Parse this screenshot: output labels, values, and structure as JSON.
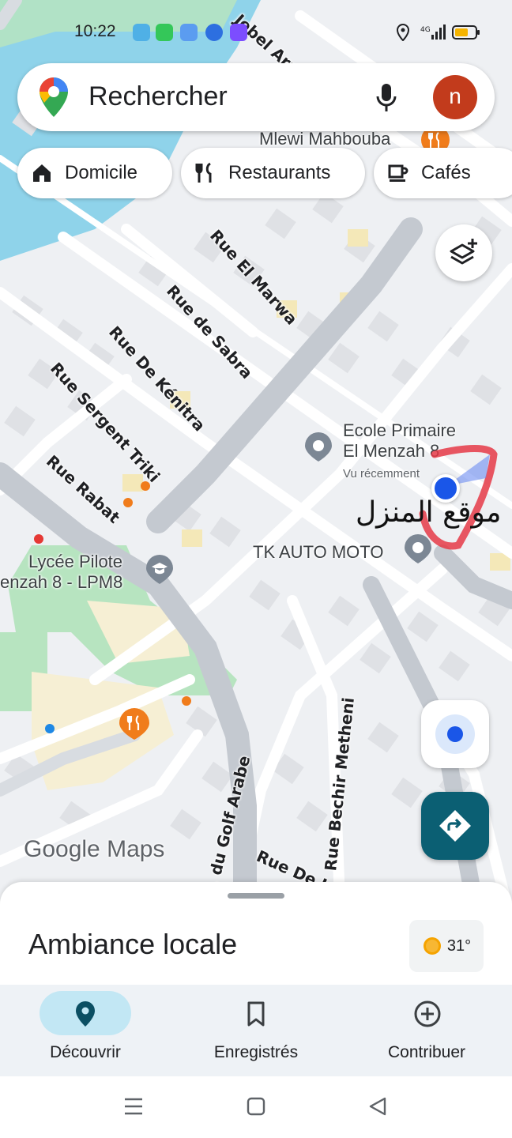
{
  "status_bar": {
    "time": "10:22"
  },
  "search": {
    "placeholder": "Rechercher",
    "avatar_letter": "n"
  },
  "chips": [
    {
      "label": "Domicile",
      "icon": "home-icon"
    },
    {
      "label": "Restaurants",
      "icon": "restaurant-icon"
    },
    {
      "label": "Cafés",
      "icon": "cafe-icon"
    }
  ],
  "map": {
    "streets": [
      {
        "name": "Jebel Arafa"
      },
      {
        "name": "Rue El Marwa"
      },
      {
        "name": "Rue de Sabra"
      },
      {
        "name": "Rue De Kénitra"
      },
      {
        "name": "Rue Sergent Triki"
      },
      {
        "name": "Rue Rabat"
      },
      {
        "name": "v. du Golf Arabe"
      },
      {
        "name": "Rue Bechir Metheni"
      },
      {
        "name": "Rue De La"
      }
    ],
    "places": {
      "top_restaurant": "Mlewi Mahbouba",
      "school_line1": "Ecole Primaire",
      "school_line2": "El Menzah 8",
      "school_sub": "Vu récemment",
      "garage": "TK AUTO MOTO",
      "lycee_line1": "Lycée Pilote",
      "lycee_line2": "enzah 8 - LPM8"
    },
    "annotation": "موقع المنزل",
    "watermark": "Google Maps"
  },
  "sheet": {
    "title": "Ambiance locale",
    "temperature": "31°"
  },
  "nav": [
    {
      "label": "Découvrir",
      "icon": "explore-pin-icon",
      "active": true
    },
    {
      "label": "Enregistrés",
      "icon": "bookmark-icon",
      "active": false
    },
    {
      "label": "Contribuer",
      "icon": "add-circle-icon",
      "active": false
    }
  ],
  "colors": {
    "accent": "#0b5f73",
    "nav_pill": "#c2e7f4",
    "avatar": "#c23b1c",
    "location_dot": "#1a56e8",
    "poi_orange": "#f07c1b",
    "water": "#8fd3ea",
    "park": "#b7e4c0"
  }
}
